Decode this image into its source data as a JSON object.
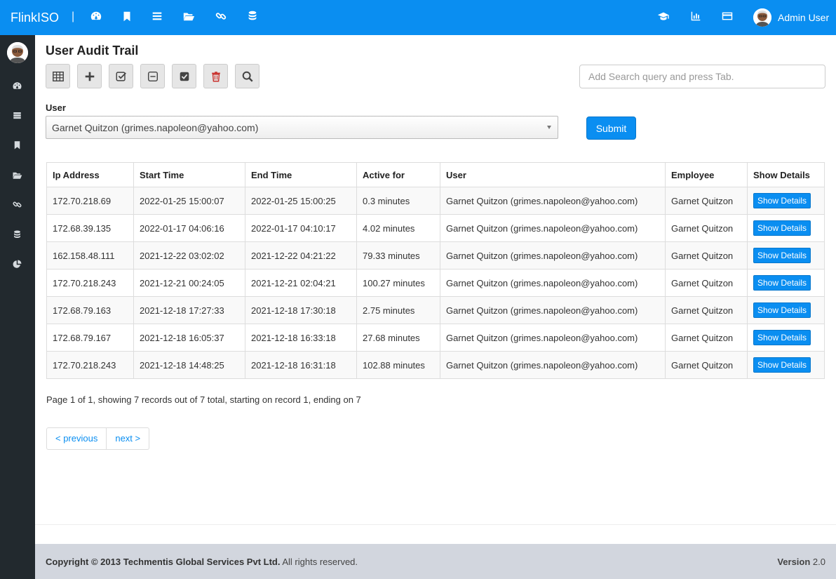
{
  "navbar": {
    "brand": "FlinkISO",
    "separator": "|",
    "left_icons": [
      "dashboard-icon",
      "bookmark-icon",
      "list-icon",
      "folder-open-icon",
      "link-icon",
      "database-icon"
    ],
    "right_icons": [
      "graduation-cap-icon",
      "bar-chart-icon",
      "credit-card-icon"
    ],
    "user_name": "Admin User"
  },
  "sidebar": {
    "icons": [
      "dashboard-icon",
      "server-icon",
      "bookmark-icon",
      "folder-open-icon",
      "link-icon",
      "database-icon",
      "pie-chart-icon"
    ]
  },
  "page": {
    "title": "User Audit Trail"
  },
  "toolbar": {
    "buttons": [
      "table-icon",
      "plus-icon",
      "check-square-icon",
      "minus-square-icon",
      "checked-square-icon",
      "trash-icon",
      "search-icon"
    ],
    "search_placeholder": "Add Search query and press Tab."
  },
  "filter": {
    "user_label": "User",
    "user_selected": "Garnet Quitzon (grimes.napoleon@yahoo.com)",
    "submit_label": "Submit"
  },
  "table": {
    "headers": [
      "Ip Address",
      "Start Time",
      "End Time",
      "Active for",
      "User",
      "Employee",
      "Show Details"
    ],
    "button_label": "Show Details",
    "rows": [
      {
        "ip": "172.70.218.69",
        "start": "2022-01-25 15:00:07",
        "end": "2022-01-25 15:00:25",
        "active": "0.3 minutes",
        "user": "Garnet Quitzon (grimes.napoleon@yahoo.com)",
        "employee": "Garnet Quitzon"
      },
      {
        "ip": "172.68.39.135",
        "start": "2022-01-17 04:06:16",
        "end": "2022-01-17 04:10:17",
        "active": "4.02 minutes",
        "user": "Garnet Quitzon (grimes.napoleon@yahoo.com)",
        "employee": "Garnet Quitzon"
      },
      {
        "ip": "162.158.48.111",
        "start": "2021-12-22 03:02:02",
        "end": "2021-12-22 04:21:22",
        "active": "79.33 minutes",
        "user": "Garnet Quitzon (grimes.napoleon@yahoo.com)",
        "employee": "Garnet Quitzon"
      },
      {
        "ip": "172.70.218.243",
        "start": "2021-12-21 00:24:05",
        "end": "2021-12-21 02:04:21",
        "active": "100.27 minutes",
        "user": "Garnet Quitzon (grimes.napoleon@yahoo.com)",
        "employee": "Garnet Quitzon"
      },
      {
        "ip": "172.68.79.163",
        "start": "2021-12-18 17:27:33",
        "end": "2021-12-18 17:30:18",
        "active": "2.75 minutes",
        "user": "Garnet Quitzon (grimes.napoleon@yahoo.com)",
        "employee": "Garnet Quitzon"
      },
      {
        "ip": "172.68.79.167",
        "start": "2021-12-18 16:05:37",
        "end": "2021-12-18 16:33:18",
        "active": "27.68 minutes",
        "user": "Garnet Quitzon (grimes.napoleon@yahoo.com)",
        "employee": "Garnet Quitzon"
      },
      {
        "ip": "172.70.218.243",
        "start": "2021-12-18 14:48:25",
        "end": "2021-12-18 16:31:18",
        "active": "102.88 minutes",
        "user": "Garnet Quitzon (grimes.napoleon@yahoo.com)",
        "employee": "Garnet Quitzon"
      }
    ]
  },
  "pagination": {
    "info": "Page 1 of 1, showing 7 records out of 7 total, starting on record 1, ending on 7",
    "previous": "< previous",
    "next": "next >"
  },
  "footer": {
    "copyright_prefix": "Copyright © 2013",
    "company": "Techmentis Global Services Pvt Ltd.",
    "rights": "All rights reserved.",
    "version_label": "Version",
    "version_value": "2.0"
  },
  "colors": {
    "primary": "#0a8ef1",
    "sidebar": "#22292e",
    "footer": "#d2d6de",
    "danger": "#c9302c"
  }
}
